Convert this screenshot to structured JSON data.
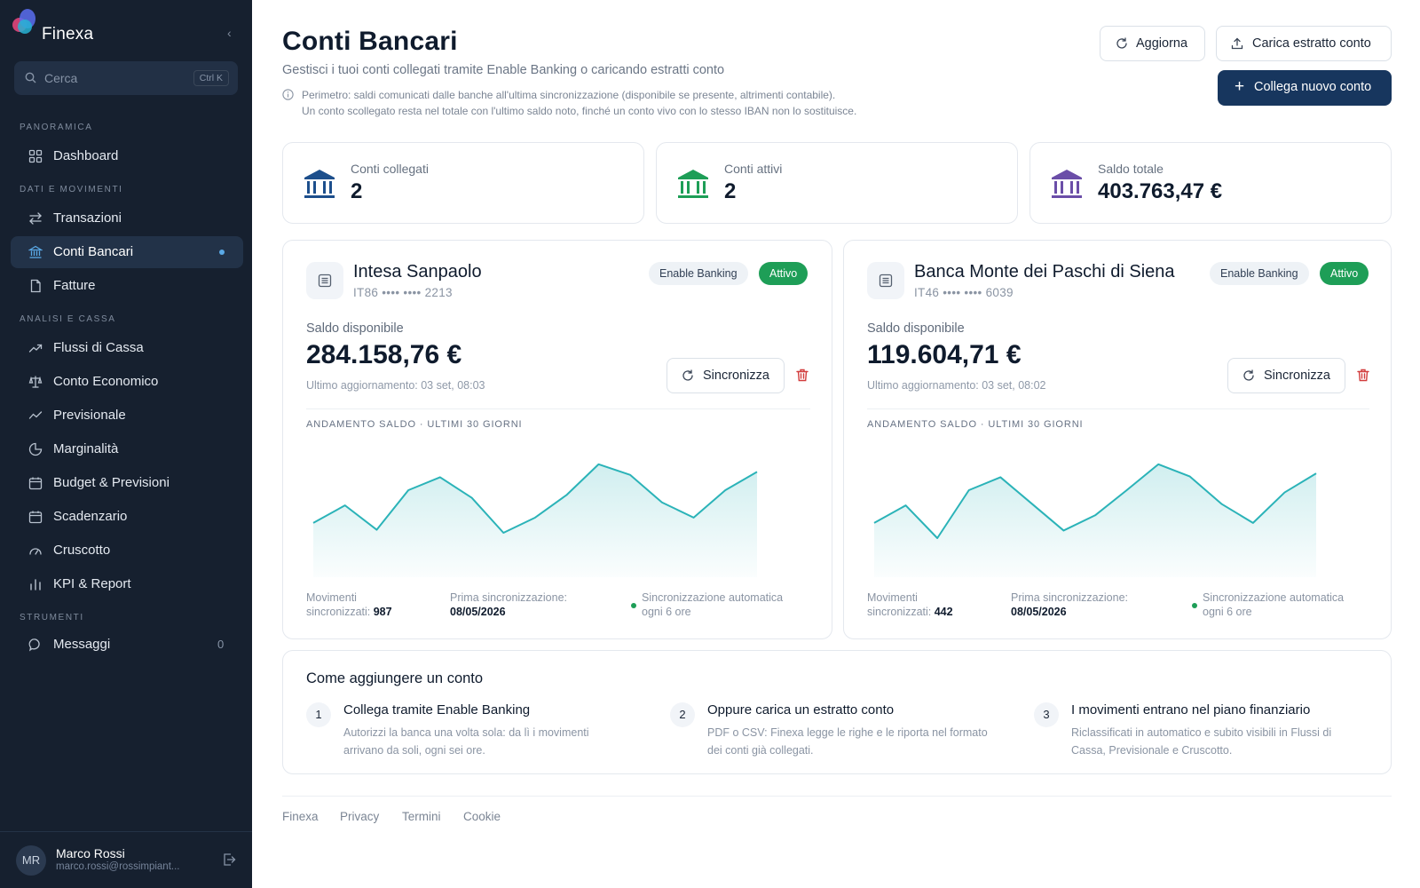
{
  "sidebar": {
    "brand": "Finexa",
    "search_placeholder": "Cerca",
    "search_shortcut": "Ctrl K",
    "sections": {
      "overview": "PANORAMICA",
      "data": "DATI E MOVIMENTI",
      "analysis": "ANALISI E CASSA",
      "tools": "STRUMENTI"
    },
    "items": {
      "dashboard": "Dashboard",
      "transactions": "Transazioni",
      "bank_accounts": "Conti Bancari",
      "invoices": "Fatture",
      "cash_flow": "Flussi di Cassa",
      "income_statement": "Conto Economico",
      "forecast": "Previsionale",
      "margins": "Marginalità",
      "budget": "Budget & Previsioni",
      "deadlines": "Scadenzario",
      "cockpit": "Cruscotto",
      "kpi": "KPI & Report",
      "messages": "Messaggi"
    },
    "messages_count": "0",
    "active_item": "bank_accounts",
    "user": {
      "initials": "MR",
      "name": "Marco Rossi",
      "email": "marco.rossi@rossimpiant..."
    }
  },
  "header": {
    "title": "Conti Bancari",
    "subtitle": "Gestisci i tuoi conti collegati tramite Enable Banking o caricando estratti conto",
    "note_line1": "Perimetro: saldi comunicati dalle banche all'ultima sincronizzazione (disponibile se presente, altrimenti contabile).",
    "note_line2": "Un conto scollegato resta nel totale con l'ultimo saldo noto, finché un conto vivo con lo stesso IBAN non lo sostituisce.",
    "refresh_label": "Aggiorna",
    "upload_label": "Carica estratto conto",
    "connect_label": "Collega nuovo conto"
  },
  "stats": [
    {
      "label": "Conti collegati",
      "value": "2",
      "color": "#1d4f8c"
    },
    {
      "label": "Conti attivi",
      "value": "2",
      "color": "#1e9e57"
    },
    {
      "label": "Saldo totale",
      "value": "403.763,47 €",
      "color": "#6b4ea8"
    }
  ],
  "accounts": [
    {
      "name": "Intesa Sanpaolo",
      "iban": "IT86 •••• •••• 2213",
      "source": "Enable Banking",
      "status": "Attivo",
      "balance_label": "Saldo disponibile",
      "balance": "284.158,76 €",
      "updated": "Ultimo aggiornamento: 03 set, 08:03",
      "sync_label": "Sincronizza",
      "chart_label": "ANDAMENTO SALDO · ULTIMI 30 GIORNI",
      "movements_label_1": "Movimenti",
      "movements_label_2": "sincronizzati:",
      "movements": "987",
      "first_sync_label": "Prima sincronizzazione:",
      "first_sync": "08/05/2026",
      "auto_sync_1": "Sincronizzazione automatica",
      "auto_sync_2": "ogni 6 ore"
    },
    {
      "name": "Banca Monte dei Paschi di Siena",
      "iban": "IT46 •••• •••• 6039",
      "source": "Enable Banking",
      "status": "Attivo",
      "balance_label": "Saldo disponibile",
      "balance": "119.604,71 €",
      "updated": "Ultimo aggiornamento: 03 set, 08:02",
      "sync_label": "Sincronizza",
      "chart_label": "ANDAMENTO SALDO · ULTIMI 30 GIORNI",
      "movements_label_1": "Movimenti",
      "movements_label_2": "sincronizzati:",
      "movements": "442",
      "first_sync_label": "Prima sincronizzazione:",
      "first_sync": "08/05/2026",
      "auto_sync_1": "Sincronizzazione automatica",
      "auto_sync_2": "ogni 6 ore"
    }
  ],
  "chart_data": [
    {
      "type": "area",
      "values": [
        0.55,
        0.78,
        0.46,
        0.98,
        1.15,
        0.88,
        0.42,
        0.62,
        0.92,
        1.32,
        1.18,
        0.82,
        0.62,
        0.98,
        1.22
      ],
      "color": "#2bb3b8"
    },
    {
      "type": "area",
      "values": [
        0.55,
        0.78,
        0.35,
        0.98,
        1.15,
        0.8,
        0.45,
        0.65,
        0.98,
        1.32,
        1.16,
        0.8,
        0.55,
        0.95,
        1.2
      ],
      "color": "#2bb3b8"
    }
  ],
  "howto": {
    "title": "Come aggiungere un conto",
    "steps": [
      {
        "num": "1",
        "title": "Collega tramite Enable Banking",
        "desc": "Autorizzi la banca una volta sola: da lì i movimenti arrivano da soli, ogni sei ore."
      },
      {
        "num": "2",
        "title": "Oppure carica un estratto conto",
        "desc": "PDF o CSV: Finexa legge le righe e le riporta nel formato dei conti già collegati."
      },
      {
        "num": "3",
        "title": "I movimenti entrano nel piano finanziario",
        "desc": "Riclassificati in automatico e subito visibili in Flussi di Cassa, Previsionale e Cruscotto."
      }
    ]
  },
  "footer": {
    "links": [
      "Finexa",
      "Privacy",
      "Termini",
      "Cookie"
    ]
  }
}
